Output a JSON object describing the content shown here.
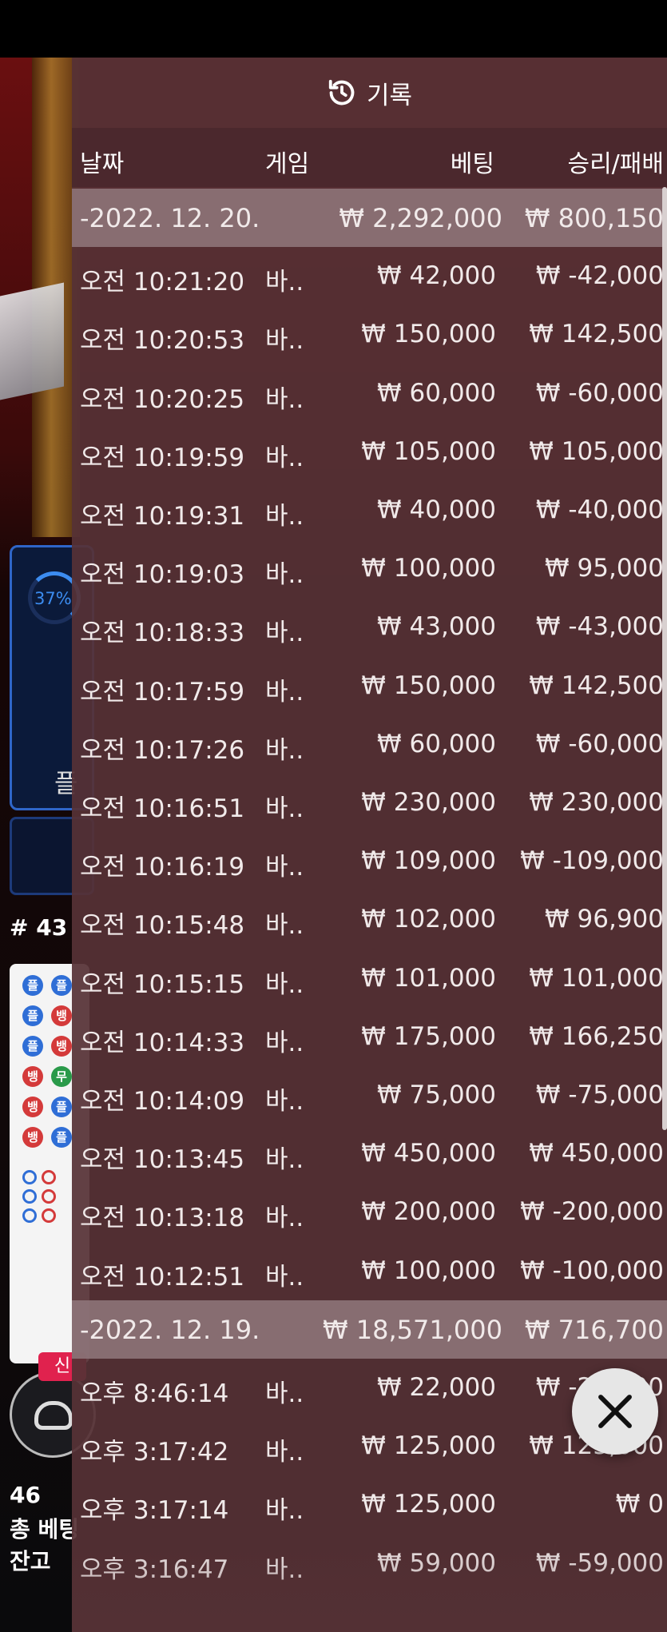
{
  "panel": {
    "title": "기록",
    "columns": {
      "date": "날짜",
      "game": "게임",
      "bet": "베팅",
      "result": "승리/패배"
    },
    "groups": [
      {
        "date": "-2022. 12. 20.",
        "total_bet": "₩ 2,292,000",
        "total_result": "₩ 800,150",
        "rows": [
          {
            "time": "오전 10:21:20",
            "game": "바..",
            "bet": "₩ 42,000",
            "result": "₩ -42,000"
          },
          {
            "time": "오전 10:20:53",
            "game": "바..",
            "bet": "₩ 150,000",
            "result": "₩ 142,500"
          },
          {
            "time": "오전 10:20:25",
            "game": "바..",
            "bet": "₩ 60,000",
            "result": "₩ -60,000"
          },
          {
            "time": "오전 10:19:59",
            "game": "바..",
            "bet": "₩ 105,000",
            "result": "₩ 105,000"
          },
          {
            "time": "오전 10:19:31",
            "game": "바..",
            "bet": "₩ 40,000",
            "result": "₩ -40,000"
          },
          {
            "time": "오전 10:19:03",
            "game": "바..",
            "bet": "₩ 100,000",
            "result": "₩ 95,000"
          },
          {
            "time": "오전 10:18:33",
            "game": "바..",
            "bet": "₩ 43,000",
            "result": "₩ -43,000"
          },
          {
            "time": "오전 10:17:59",
            "game": "바..",
            "bet": "₩ 150,000",
            "result": "₩ 142,500"
          },
          {
            "time": "오전 10:17:26",
            "game": "바..",
            "bet": "₩ 60,000",
            "result": "₩ -60,000"
          },
          {
            "time": "오전 10:16:51",
            "game": "바..",
            "bet": "₩ 230,000",
            "result": "₩ 230,000"
          },
          {
            "time": "오전 10:16:19",
            "game": "바..",
            "bet": "₩ 109,000",
            "result": "₩ -109,000"
          },
          {
            "time": "오전 10:15:48",
            "game": "바..",
            "bet": "₩ 102,000",
            "result": "₩ 96,900"
          },
          {
            "time": "오전 10:15:15",
            "game": "바..",
            "bet": "₩ 101,000",
            "result": "₩ 101,000"
          },
          {
            "time": "오전 10:14:33",
            "game": "바..",
            "bet": "₩ 175,000",
            "result": "₩ 166,250"
          },
          {
            "time": "오전 10:14:09",
            "game": "바..",
            "bet": "₩ 75,000",
            "result": "₩ -75,000"
          },
          {
            "time": "오전 10:13:45",
            "game": "바..",
            "bet": "₩ 450,000",
            "result": "₩ 450,000"
          },
          {
            "time": "오전 10:13:18",
            "game": "바..",
            "bet": "₩ 200,000",
            "result": "₩ -200,000"
          },
          {
            "time": "오전 10:12:51",
            "game": "바..",
            "bet": "₩ 100,000",
            "result": "₩ -100,000"
          }
        ]
      },
      {
        "date": "-2022. 12. 19.",
        "total_bet": "₩ 18,571,000",
        "total_result": "₩ 716,700",
        "rows": [
          {
            "time": "오후 8:46:14",
            "game": "바..",
            "bet": "₩ 22,000",
            "result": "₩ -22,000"
          },
          {
            "time": "오후 3:17:42",
            "game": "바..",
            "bet": "₩ 125,000",
            "result": "₩ 125,000"
          },
          {
            "time": "오후 3:17:14",
            "game": "바..",
            "bet": "₩ 125,000",
            "result": "₩ 0"
          },
          {
            "time": "오후 3:16:47",
            "game": "바..",
            "bet": "₩ 59,000",
            "result": "₩ -59,000"
          }
        ]
      }
    ]
  },
  "background": {
    "stat_percent": "37%",
    "stat_letter": "플",
    "round_number": "# 43",
    "new_badge": "신",
    "players_count": "46",
    "total_bet_label": "총 베팅",
    "balance_label": "잔고",
    "balance_prefix": "₩",
    "roadmap_big": [
      "플",
      "플",
      "플",
      "뱅",
      "플",
      "뱅",
      "뱅",
      "무",
      "뱅",
      "플",
      "뱅",
      "플"
    ]
  },
  "colors": {
    "panel": "#563236",
    "group_row": "#91787c",
    "close_button": "#e6e6e6"
  },
  "icons": {
    "history": "history-icon",
    "close": "close-icon"
  }
}
